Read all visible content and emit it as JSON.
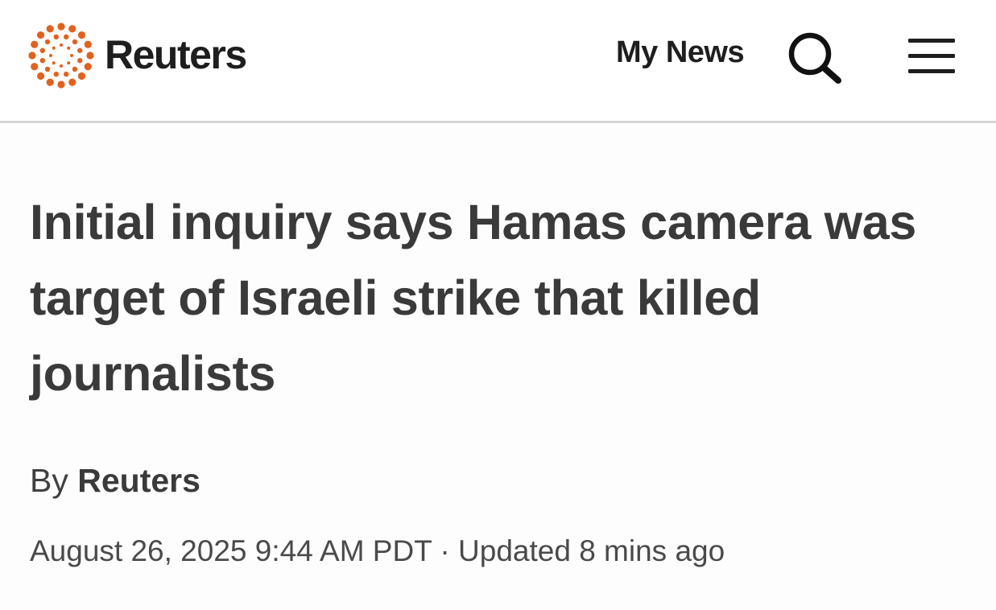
{
  "header": {
    "brand": "Reuters",
    "brand_color": "#e1611e",
    "my_news_label": "My News",
    "search_icon": "search-icon",
    "menu_icon": "hamburger-menu-icon"
  },
  "article": {
    "headline": "Initial inquiry says Hamas camera was target of Israeli strike that killed journalists",
    "byline_prefix": "By",
    "byline_author": "Reuters",
    "published": "August 26, 2025 9:44 AM PDT",
    "separator": "·",
    "updated": "Updated 8 mins ago"
  }
}
